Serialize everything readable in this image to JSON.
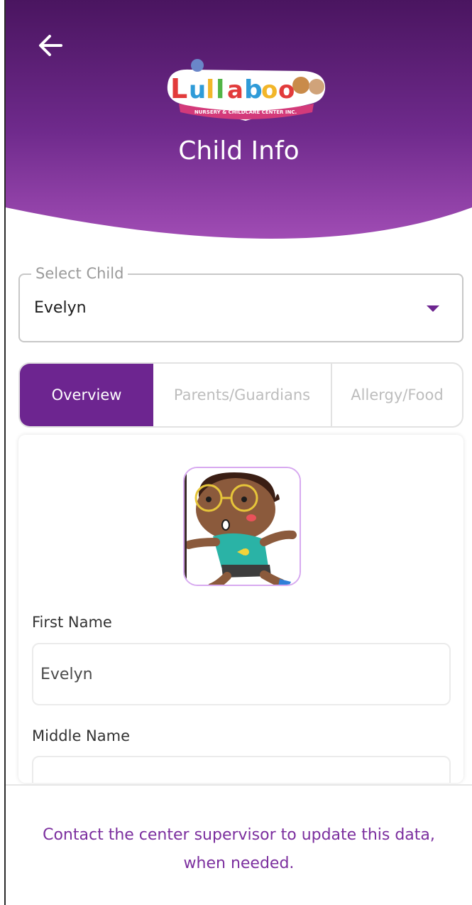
{
  "header": {
    "title": "Child Info",
    "back_icon": "arrow-left-icon",
    "logo": {
      "name": "Lullaboo",
      "tagline": "NURSERY & CHILDCARE CENTER INC."
    }
  },
  "select_child": {
    "label": "Select Child",
    "value": "Evelyn"
  },
  "tabs": [
    {
      "label": "Overview",
      "active": true
    },
    {
      "label": "Parents/Guardians",
      "active": false
    },
    {
      "label": "Allergy/Food",
      "active": false
    }
  ],
  "form": {
    "first_name": {
      "label": "First Name",
      "value": "Evelyn"
    },
    "middle_name": {
      "label": "Middle Name",
      "value": ""
    }
  },
  "footer": {
    "message": "Contact the center supervisor to update this data, when needed."
  },
  "colors": {
    "primary": "#6d2590",
    "header_top": "#4a1560",
    "header_bottom": "#a04cb4",
    "footer_text": "#7b2e9e"
  }
}
